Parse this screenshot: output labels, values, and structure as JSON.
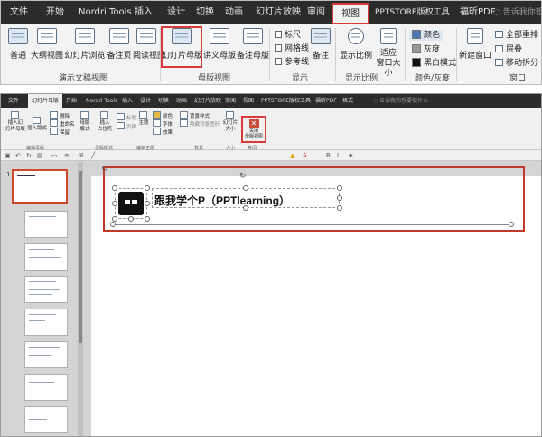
{
  "top": {
    "tabs": [
      "文件",
      "开始",
      "Nordri Tools",
      "插入",
      "设计",
      "切换",
      "动画",
      "幻灯片放映",
      "审阅",
      "视图",
      "PPTSTORE版权工具",
      "福昕PDF"
    ],
    "search": "告诉我你想",
    "buttons": {
      "normal": "普通",
      "outline": "大纲视图",
      "sorter": "幻灯片浏览",
      "notes_page": "备注页",
      "reading": "阅读视图",
      "slide_master": "幻灯片母版",
      "handout_master": "讲义母版",
      "notes_master": "备注母版",
      "notes": "备注",
      "zoom": "显示比例",
      "fit_window": "适应\n窗口大小",
      "new_window": "新建窗口"
    },
    "checks": [
      "标尺",
      "网格线",
      "参考线"
    ],
    "color_opts": [
      "颜色",
      "灰度",
      "黑白模式"
    ],
    "window_opts": [
      "全部重排",
      "层叠",
      "移动拆分"
    ],
    "groups": {
      "presentation_views": "演示文稿视图",
      "master_views": "母版视图",
      "show": "显示",
      "zoom": "显示比例",
      "color_gray": "颜色/灰度",
      "window": "窗口"
    }
  },
  "bottom": {
    "tabs": [
      "文件",
      "幻灯片母版",
      "开始",
      "Nordri Tools",
      "插入",
      "设计",
      "切换",
      "动画",
      "幻灯片放映",
      "审阅",
      "视图",
      "PPTSTORE版权工具",
      "福昕PDF",
      "格式"
    ],
    "search": "告诉我你想要做什么",
    "ribbon": {
      "insert_master": "插入幻\n灯片母版",
      "insert_layout": "插入版式",
      "delete": "删除",
      "rename": "重命名",
      "preserve": "保留",
      "master_layout": "母版\n版式",
      "insert_placeholder": "插入\n占位符",
      "title": "标题",
      "footer": "页脚",
      "theme": "主题",
      "colors": "颜色",
      "fonts": "字体",
      "effects": "效果",
      "bg_styles": "背景样式",
      "hide_bg": "隐藏背景图形",
      "slide_size": "幻灯片\n大小",
      "close_master": "关闭\n母版视图",
      "groups": {
        "edit_master": "编辑母版",
        "master_layout": "母版版式",
        "edit_theme": "编辑主题",
        "background": "背景",
        "size": "大小",
        "close": "关闭"
      }
    },
    "slide_numbers": [
      "1"
    ],
    "title_text": "跟我学个P（PPTlearning）"
  }
}
